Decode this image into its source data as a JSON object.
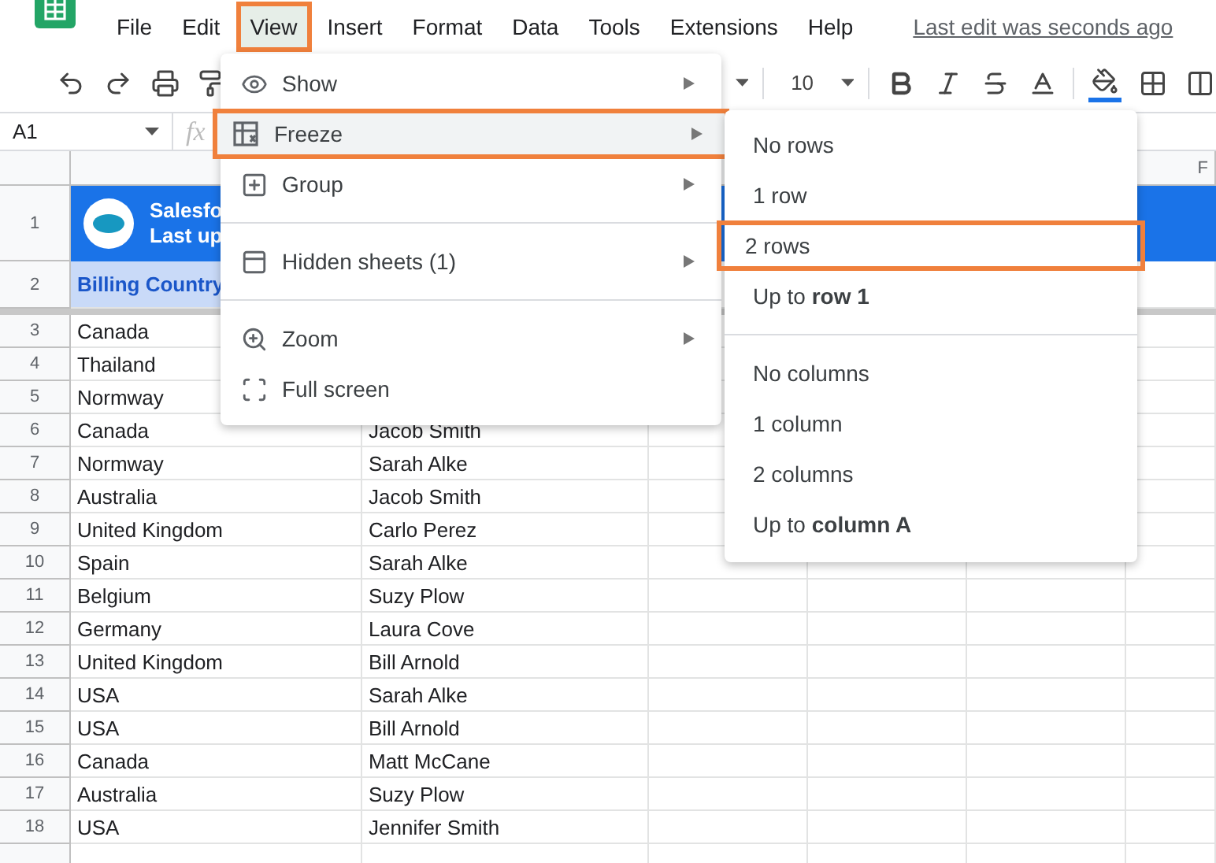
{
  "menu_bar": {
    "items": [
      {
        "label": "File",
        "selected": false
      },
      {
        "label": "Edit",
        "selected": false
      },
      {
        "label": "View",
        "selected": true
      },
      {
        "label": "Insert",
        "selected": false
      },
      {
        "label": "Format",
        "selected": false
      },
      {
        "label": "Data",
        "selected": false
      },
      {
        "label": "Tools",
        "selected": false
      },
      {
        "label": "Extensions",
        "selected": false
      },
      {
        "label": "Help",
        "selected": false
      }
    ],
    "last_edit": "Last edit was seconds ago"
  },
  "toolbar": {
    "font_size": "10"
  },
  "formula_bar": {
    "name_box": "A1",
    "fx": "fx"
  },
  "sheet": {
    "column_header": "F",
    "banner": {
      "row": "1",
      "line_1": "Salesfo",
      "line_2": "Last up"
    },
    "header_row": {
      "row": "2",
      "cell": "Billing Country"
    },
    "rows": [
      {
        "row": "3",
        "column_a": "Canada"
      },
      {
        "row": "4",
        "column_a": "Thailand"
      },
      {
        "row": "5",
        "column_a": "Normway"
      },
      {
        "row": "6",
        "column_a": "Canada",
        "column_b": "Jacob Smith"
      },
      {
        "row": "7",
        "column_a": "Normway",
        "column_b": "Sarah Alke"
      },
      {
        "row": "8",
        "column_a": "Australia",
        "column_b": "Jacob Smith"
      },
      {
        "row": "9",
        "column_a": "United Kingdom",
        "column_b": "Carlo Perez"
      },
      {
        "row": "10",
        "column_a": "Spain",
        "column_b": "Sarah Alke"
      },
      {
        "row": "11",
        "column_a": "Belgium",
        "column_b": "Suzy Plow"
      },
      {
        "row": "12",
        "column_a": "Germany",
        "column_b": "Laura Cove"
      },
      {
        "row": "13",
        "column_a": "United Kingdom",
        "column_b": "Bill Arnold"
      },
      {
        "row": "14",
        "column_a": "USA",
        "column_b": "Sarah Alke"
      },
      {
        "row": "15",
        "column_a": "USA",
        "column_b": "Bill Arnold"
      },
      {
        "row": "16",
        "column_a": "Canada",
        "column_b": "Matt McCane"
      },
      {
        "row": "17",
        "column_a": "Australia",
        "column_b": "Suzy Plow"
      },
      {
        "row": "18",
        "column_a": "USA",
        "column_b": "Jennifer Smith"
      }
    ]
  },
  "view_menu": {
    "items": [
      {
        "kind": "item",
        "label": "Show",
        "submenu": true,
        "selected": false
      },
      {
        "kind": "item",
        "label": "Freeze",
        "submenu": true,
        "selected": true
      },
      {
        "kind": "item",
        "label": "Group",
        "submenu": true,
        "selected": false
      },
      {
        "kind": "divider"
      },
      {
        "kind": "item",
        "label": "Hidden sheets (1)",
        "submenu": true,
        "selected": false
      },
      {
        "kind": "divider"
      },
      {
        "kind": "item",
        "label": "Zoom",
        "submenu": true,
        "selected": false
      },
      {
        "kind": "item",
        "label": "Full screen",
        "submenu": false,
        "selected": false
      }
    ]
  },
  "freeze_menu": {
    "items": [
      {
        "kind": "item",
        "label": "No rows",
        "selected": false
      },
      {
        "kind": "item",
        "label": "1 row",
        "selected": false
      },
      {
        "kind": "item",
        "label": "2 rows",
        "selected": true
      },
      {
        "kind": "item",
        "label": "Up to **row 1**",
        "selected": false
      },
      {
        "kind": "divider"
      },
      {
        "kind": "item",
        "label": "No columns",
        "selected": false
      },
      {
        "kind": "item",
        "label": "1 column",
        "selected": false
      },
      {
        "kind": "item",
        "label": "2 columns",
        "selected": false
      },
      {
        "kind": "item",
        "label": "Up to **column A**",
        "selected": false
      }
    ]
  }
}
